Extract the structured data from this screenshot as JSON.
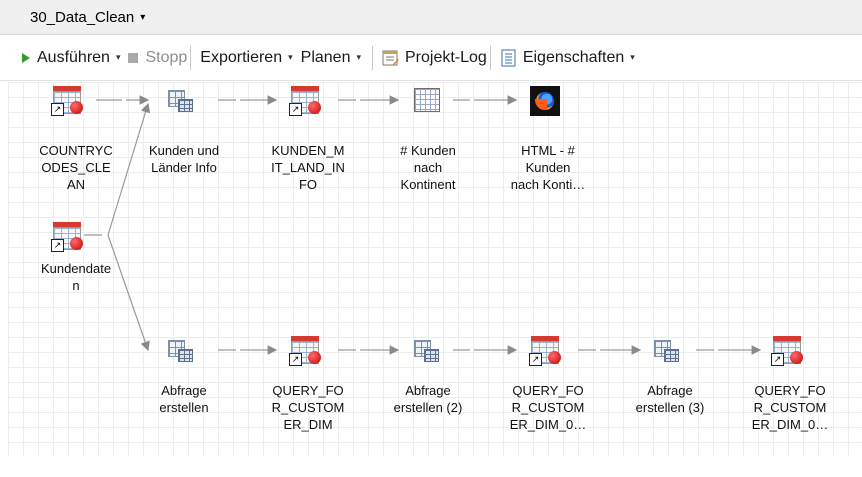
{
  "tab": {
    "title": "30_Data_Clean"
  },
  "toolbar": {
    "run": "Ausführen",
    "stop": "Stopp",
    "export": "Exportieren",
    "schedule": "Planen",
    "project_log": "Projekt-Log",
    "properties": "Eigenschaften"
  },
  "nodes": {
    "countrycodes": {
      "l1": "COUNTRYC",
      "l2": "ODES_CLE",
      "l3": "AN"
    },
    "kunden_laender": {
      "l1": "Kunden und",
      "l2": "Länder Info"
    },
    "kunden_mit_land": {
      "l1": "KUNDEN_M",
      "l2": "IT_LAND_IN",
      "l3": "FO"
    },
    "kunden_kontinent": {
      "l1": "# Kunden",
      "l2": "nach",
      "l3": "Kontinent"
    },
    "html_kunden": {
      "l1": "HTML - #",
      "l2": "Kunden",
      "l3": "nach Konti…"
    },
    "kundendaten": {
      "l1": "Kundendate",
      "l2": "n"
    },
    "abfrage1": {
      "l1": "Abfrage",
      "l2": "erstellen"
    },
    "query1": {
      "l1": "QUERY_FO",
      "l2": "R_CUSTOM",
      "l3": "ER_DIM"
    },
    "abfrage2": {
      "l1": "Abfrage",
      "l2": "erstellen (2)"
    },
    "query2": {
      "l1": "QUERY_FO",
      "l2": "R_CUSTOM",
      "l3": "ER_DIM_0…"
    },
    "abfrage3": {
      "l1": "Abfrage",
      "l2": "erstellen (3)"
    },
    "query3": {
      "l1": "QUERY_FO",
      "l2": "R_CUSTOM",
      "l3": "ER_DIM_0…"
    }
  }
}
